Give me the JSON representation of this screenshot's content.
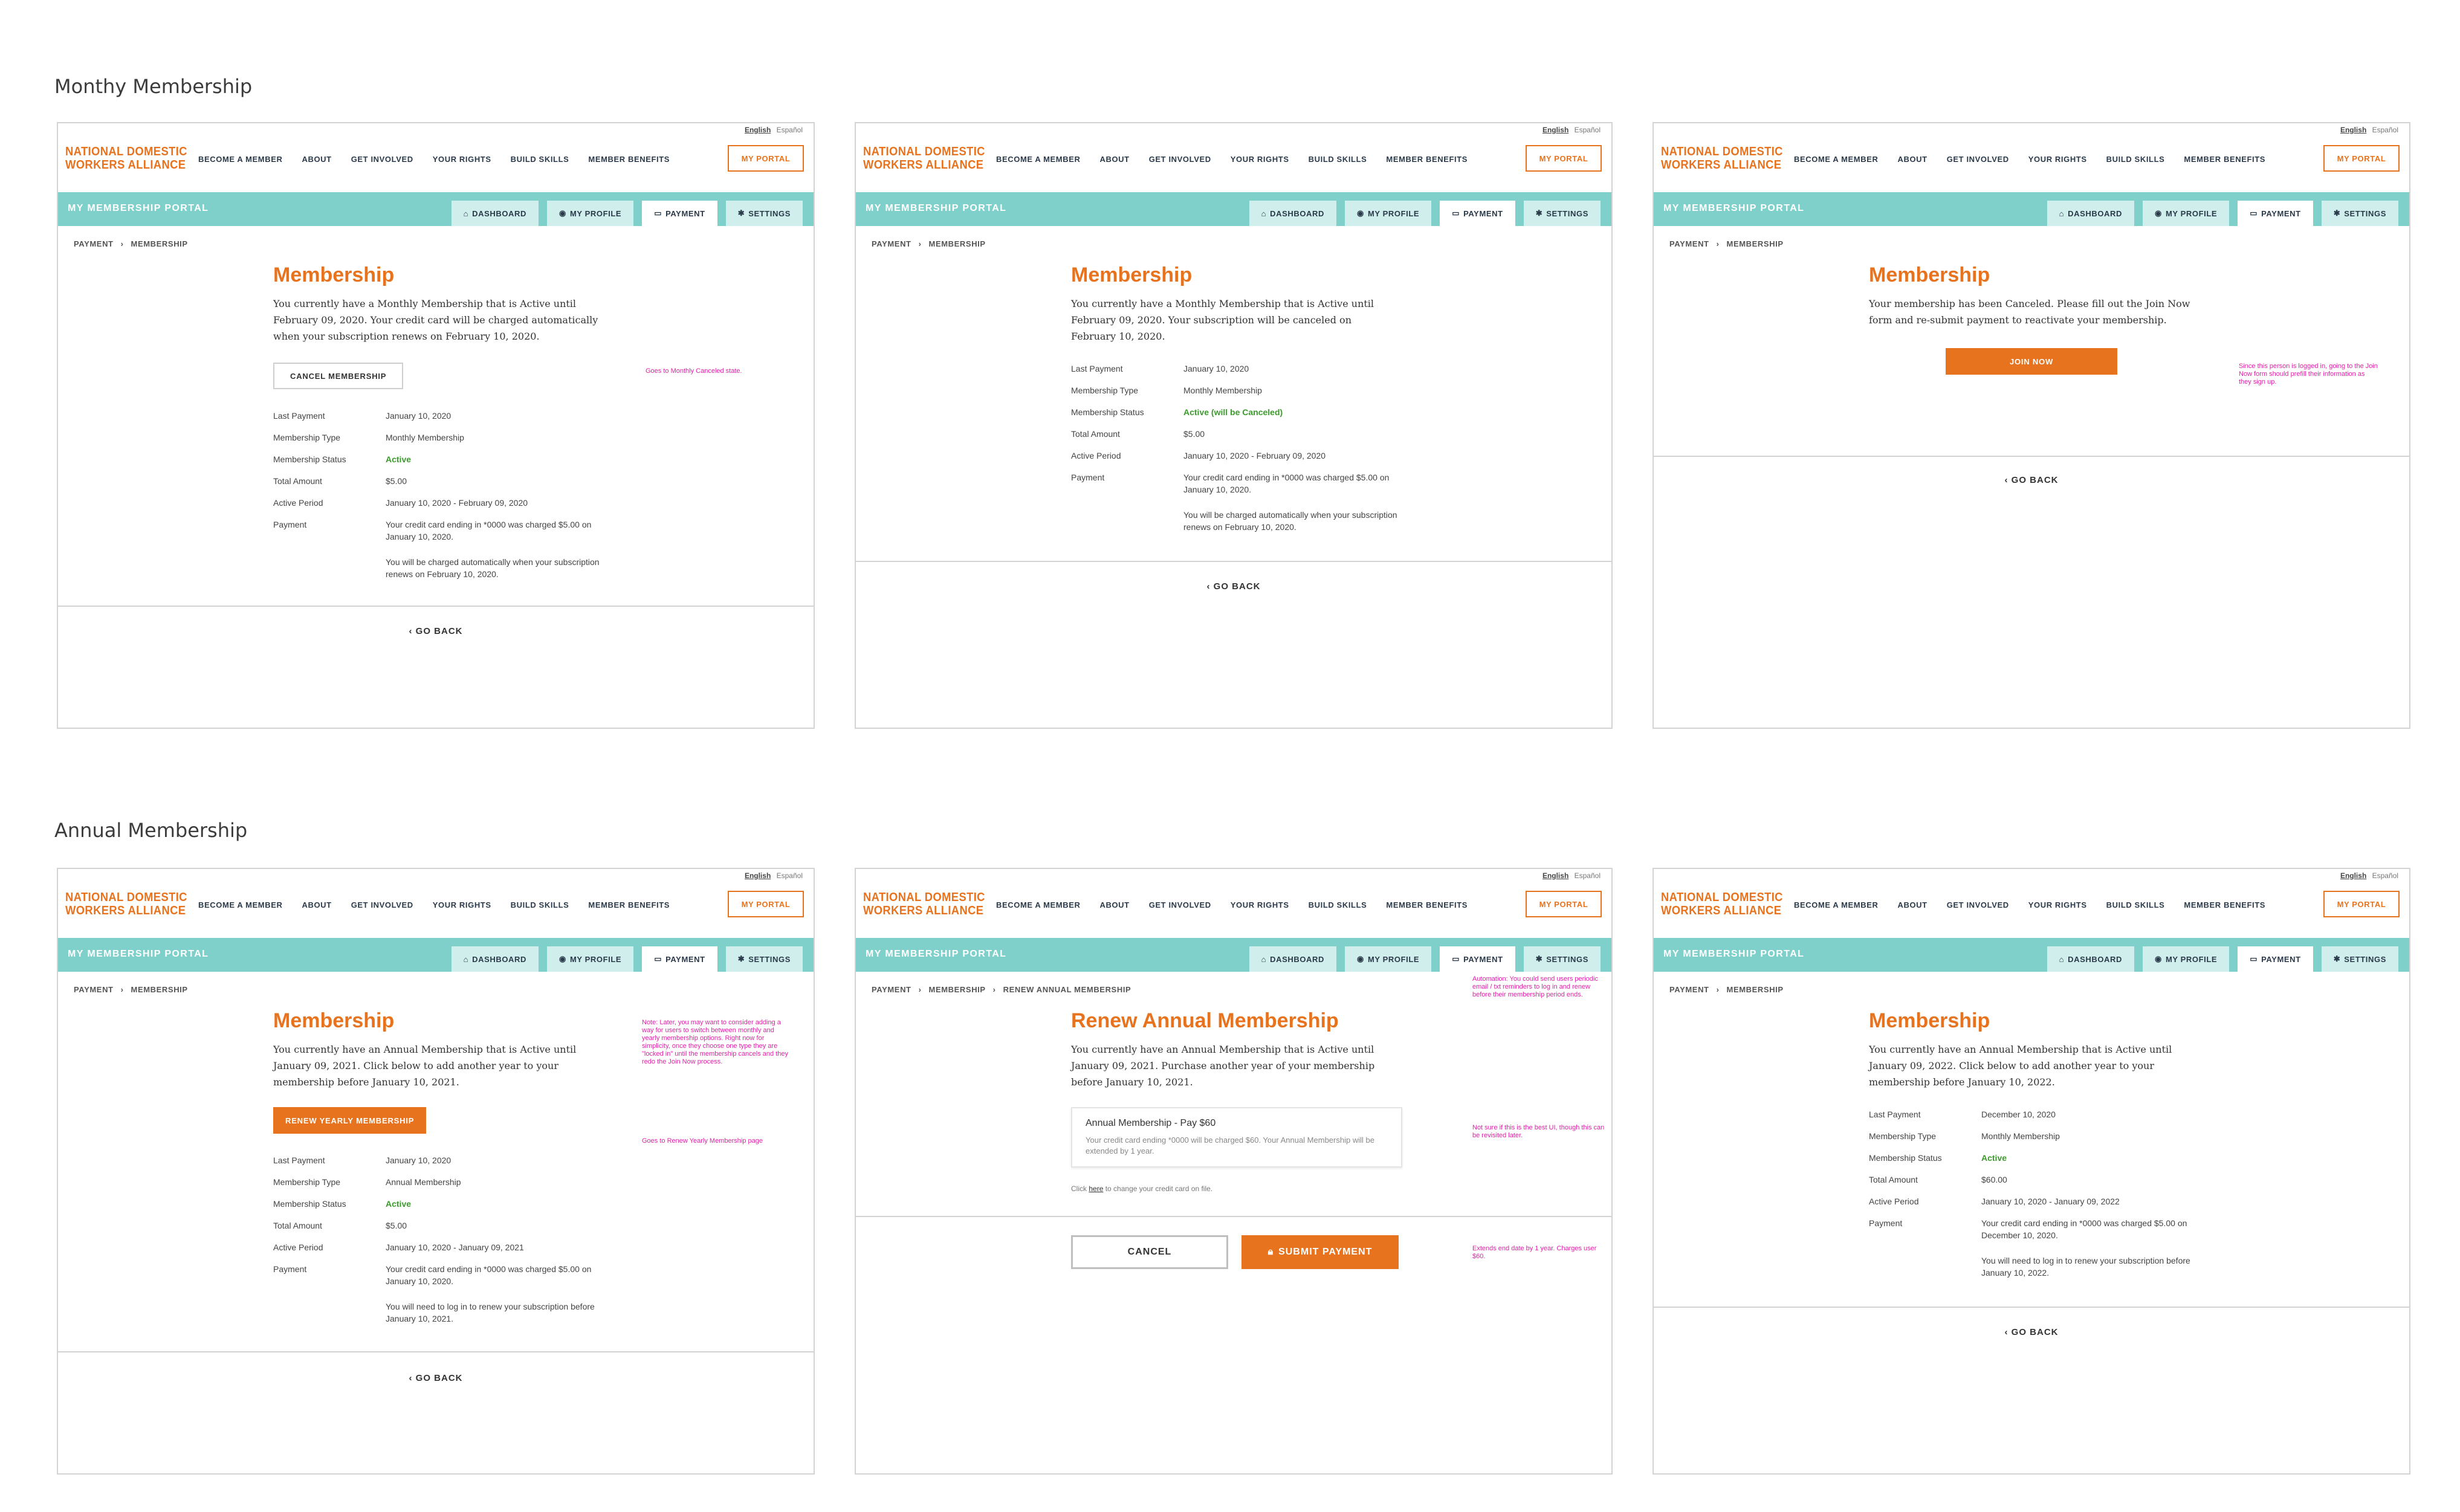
{
  "sections": {
    "monthly": "Monthy Membership",
    "annual": "Annual Membership"
  },
  "lang": {
    "english": "English",
    "espanol": "Español"
  },
  "logo": {
    "line1": "NATIONAL DOMESTIC",
    "line2": "WORKERS ALLIANCE"
  },
  "nav": [
    "BECOME A MEMBER",
    "ABOUT",
    "GET INVOLVED",
    "YOUR RIGHTS",
    "BUILD SKILLS",
    "MEMBER BENEFITS"
  ],
  "my_portal": "MY PORTAL",
  "portal_title": "MY MEMBERSHIP PORTAL",
  "tabs": {
    "dashboard": "DASHBOARD",
    "profile": "MY PROFILE",
    "payment": "PAYMENT",
    "settings": "SETTINGS"
  },
  "crumbs": {
    "payment": "PAYMENT",
    "membership": "MEMBERSHIP",
    "renew": "RENEW ANNUAL MEMBERSHIP",
    "sep": "›"
  },
  "go_back": "‹ GO BACK",
  "labels": {
    "last_payment": "Last Payment",
    "membership_type": "Membership Type",
    "membership_status": "Membership Status",
    "total_amount": "Total Amount",
    "active_period": "Active Period",
    "payment": "Payment"
  },
  "screens": {
    "m1": {
      "title": "Membership",
      "intro": "You currently have a Monthly Membership that is Active until February 09, 2020. Your credit card will be charged automatically when your subscription renews on February 10, 2020.",
      "button": "CANCEL MEMBERSHIP",
      "annotation": "Goes to Monthly Canceled state.",
      "last_payment": "January 10, 2020",
      "type": "Monthly Membership",
      "status": "Active",
      "total": "$5.00",
      "period": "January 10, 2020 - February 09, 2020",
      "payment": "Your credit card ending in *0000 was charged $5.00 on January 10, 2020.",
      "note": "You will be charged automatically when your subscription renews on February 10, 2020."
    },
    "m2": {
      "title": "Membership",
      "intro": "You currently have a Monthly Membership that is Active until February 09, 2020. Your subscription will be canceled on February 10, 2020.",
      "last_payment": "January 10, 2020",
      "type": "Monthly Membership",
      "status": "Active (will be Canceled)",
      "total": "$5.00",
      "period": "January 10, 2020 - February 09, 2020",
      "payment": "Your credit card ending in *0000 was charged $5.00 on January 10, 2020.",
      "note": "You will be charged automatically when your subscription renews on February 10, 2020."
    },
    "m3": {
      "title": "Membership",
      "intro": "Your membership has been Canceled. Please fill out the Join Now form and re-submit payment to reactivate your membership.",
      "button": "JOIN NOW",
      "annotation": "Since this person is logged in, going to the Join Now form should prefill their information as they sign up."
    },
    "a1": {
      "title": "Membership",
      "intro": "You currently have an Annual Membership that is Active until January 09, 2021. Click below to add another year to your membership before January 10, 2021.",
      "button": "RENEW YEARLY MEMBERSHIP",
      "annotation1": "Note: Later, you may want to consider adding a way for users to switch between monthly and yearly membership options. Right now for simplicity, once they choose one type they are \"locked in\" until the membership cancels and they redo the Join Now process.",
      "annotation2": "Goes to Renew Yearly Membership page",
      "last_payment": "January 10, 2020",
      "type": "Annual Membership",
      "status": "Active",
      "total": "$5.00",
      "period": "January 10, 2020 - January 09, 2021",
      "payment": "Your credit card ending in *0000 was charged $5.00 on January 10, 2020.",
      "note": "You will need to log in to renew your subscription before January 10, 2021."
    },
    "a2": {
      "title": "Renew Annual Membership",
      "intro": "You currently have an Annual Membership that is Active until January 09, 2021. Purchase another year of your membership before January 10, 2021.",
      "card_title": "Annual Membership - Pay $60",
      "card_desc": "Your credit card ending *0000 will be charged $60. Your Annual Membership will be extended by 1 year.",
      "click_pre": "Click ",
      "click_link": "here",
      "click_post": " to change your credit card on file.",
      "cancel": "CANCEL",
      "submit": "SUBMIT PAYMENT",
      "annotation1": "Automation: You could send users periodic email / txt reminders to log in and renew before their membership period ends.",
      "annotation2": "Not sure if this is the best UI, though this can be revisited later.",
      "annotation3": "Extends end date by 1 year. Charges user $60."
    },
    "a3": {
      "title": "Membership",
      "intro": "You currently have an Annual Membership that is Active until January 09, 2022. Click below to add another year to your membership before January 10, 2022.",
      "last_payment": "December 10, 2020",
      "type": "Monthly Membership",
      "status": "Active",
      "total": "$60.00",
      "period": "January 10, 2020 - January 09, 2022",
      "payment": "Your credit card ending in *0000 was charged $5.00 on December 10, 2020.",
      "note": "You will need to log in to renew your subscription before January 10, 2022."
    }
  },
  "colors": {
    "accent": "#e8731e",
    "teal": "#7fd0cb",
    "active_green": "#3b9b2b",
    "annotation": "#e020a8"
  }
}
